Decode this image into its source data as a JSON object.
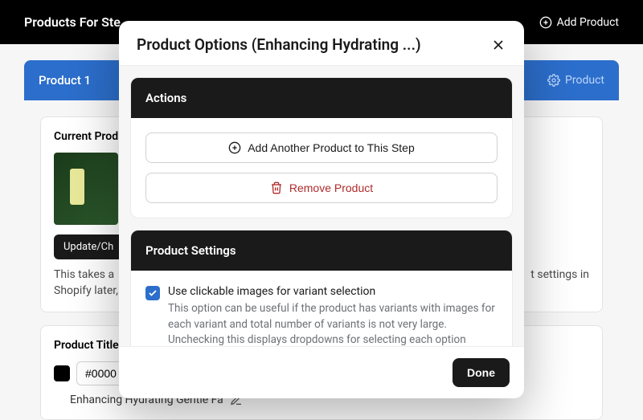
{
  "background": {
    "header_title": "Products For Ste",
    "add_product": "Add Product",
    "tab_label": "Product 1",
    "tab_right": "Product",
    "section_current": "Current Prod",
    "update_btn": "Update/Ch",
    "note_left": "This takes a ",
    "note_right": "t settings in",
    "note_below": "Shopify later,",
    "title_label": "Product Title",
    "hex_value": "#0000",
    "product_name": "Enhancing Hydrating Gentle Fa"
  },
  "modal": {
    "title": "Product Options (Enhancing Hydrating ...)",
    "actions": {
      "header": "Actions",
      "add_label": "Add Another Product to This Step",
      "remove_label": "Remove Product"
    },
    "settings": {
      "header": "Product Settings",
      "clickable_label": "Use clickable images for variant selection",
      "clickable_help": "This option can be useful if the product has variants with images for each variant and total number of variants is not very large. Unchecking this displays dropdowns for selecting each option individually."
    },
    "done": "Done"
  }
}
